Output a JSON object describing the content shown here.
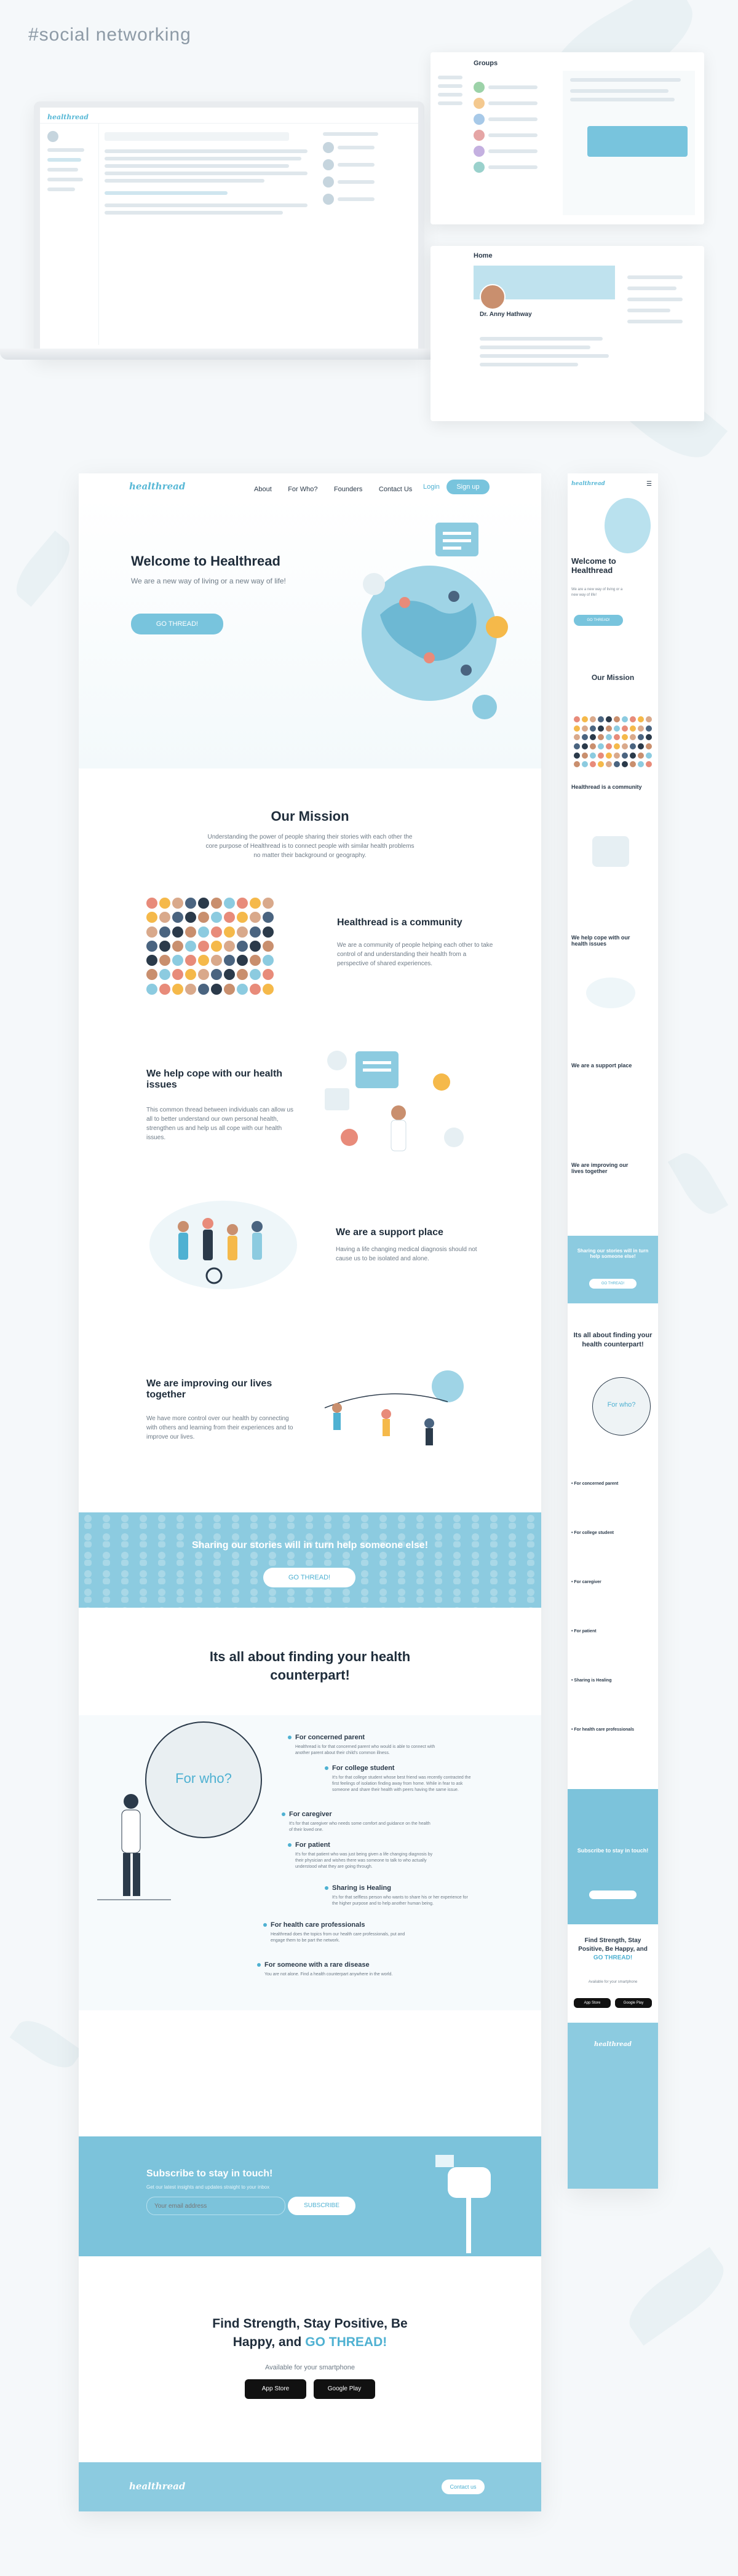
{
  "tag": "#social networking",
  "preview": {
    "laptop_logo": "healthread",
    "groups_title": "Groups",
    "profile_title": "Home",
    "profile_name": "Dr. Anny Hathway"
  },
  "site": {
    "logo": "healthread",
    "nav": [
      "About",
      "For Who?",
      "Founders",
      "Contact Us"
    ],
    "login": "Login",
    "signup": "Sign up",
    "hero_title": "Welcome to Healthread",
    "hero_sub": "We are a new way of living or a new way of life!",
    "hero_cta": "GO THREAD!",
    "mission_title": "Our Mission",
    "mission_text": "Understanding the power of people sharing their stories with each other the core purpose of Healthread is to connect people with similar health problems no matter their background or geography.",
    "features": [
      {
        "title": "Healthread is a community",
        "text": "We are a community of people helping each other to take control of and understanding their health from a perspective of shared experiences."
      },
      {
        "title": "We help cope with our health issues",
        "text": "This common thread between individuals can allow us all to better understand our own personal health, strengthen us and help us all cope with our health issues."
      },
      {
        "title": "We are a support place",
        "text": "Having a life changing medical diagnosis should not cause us to be isolated and alone."
      },
      {
        "title": "We are improving our lives together",
        "text": "We have more control over our health by connecting with others and learning from their experiences and to improve our lives."
      }
    ],
    "banner_text": "Sharing our stories will in turn help someone else!",
    "banner_cta": "GO THREAD!",
    "counterpart_title": "Its all about finding your health counterpart!",
    "for_who": "For who?",
    "audiences": [
      {
        "title": "For concerned parent",
        "text": "Healthread is for that concerned parent who would is able to connect with another parent about their child's common illness."
      },
      {
        "title": "For college student",
        "text": "It's for that college student whose best friend was recently contracted the first feelings of isolation finding away from home. While in fear to ask someone and share their health with peers having the same issue."
      },
      {
        "title": "For caregiver",
        "text": "It's for that caregiver who needs some comfort and guidance on the health of their loved one."
      },
      {
        "title": "For patient",
        "text": "It's for that patient who was just being given a life changing diagnosis by their physician and wishes there was someone to talk to who actually understood what they are going through."
      },
      {
        "title": "Sharing is Healing",
        "text": "It's for that selfless person who wants to share his or her experience for the higher purpose and to help another human being."
      },
      {
        "title": "For health care professionals",
        "text": "Healthread does the topics from our health care professionals, put and engage them to be part the network."
      },
      {
        "title": "For  someone with a rare disease",
        "text": "You are not alone. Find a health counterpart anywhere in the world."
      }
    ],
    "subscribe_title": "Subscribe to stay in touch!",
    "subscribe_sub": "Get our latest insights and updates straight to your inbox",
    "email_placeholder": "Your email address",
    "subscribe_btn": "SUBSCRIBE",
    "final_line1": "Find Strength, Stay Positive, Be",
    "final_line2": "Happy, and ",
    "final_accent": "GO THREAD!",
    "available": "Available for your smartphone",
    "app_store": "App Store",
    "google_play": "Google Play",
    "footer_btn": "Contact us"
  },
  "mobile": {
    "logo": "healthread",
    "hero_title": "Welcome to Healthread",
    "hero_sub": "We are a new way of living or a new way of life!",
    "cta": "GO THREAD!",
    "mission_title": "Our Mission",
    "f1": "Healthread is a community",
    "f2": "We help cope with our health issues",
    "f3": "We are a support place",
    "f4": "We are improving our lives together",
    "banner": "Sharing our stories will in turn help someone else!",
    "counterpart": "Its all about finding your health counterpart!",
    "for_who": "For who?",
    "aud": [
      "For concerned parent",
      "For college student",
      "For caregiver",
      "For patient",
      "Sharing is Healing",
      "For health care professionals"
    ],
    "subscribe": "Subscribe to stay in touch!",
    "final": "Find Strength, Stay Positive, Be Happy, and",
    "final_accent": "GO THREAD!",
    "available": "Available for your smartphone"
  },
  "colors": {
    "accent": "#78c4dd",
    "dark_text": "#1f2d3b",
    "bg": "#f5f8fa"
  }
}
